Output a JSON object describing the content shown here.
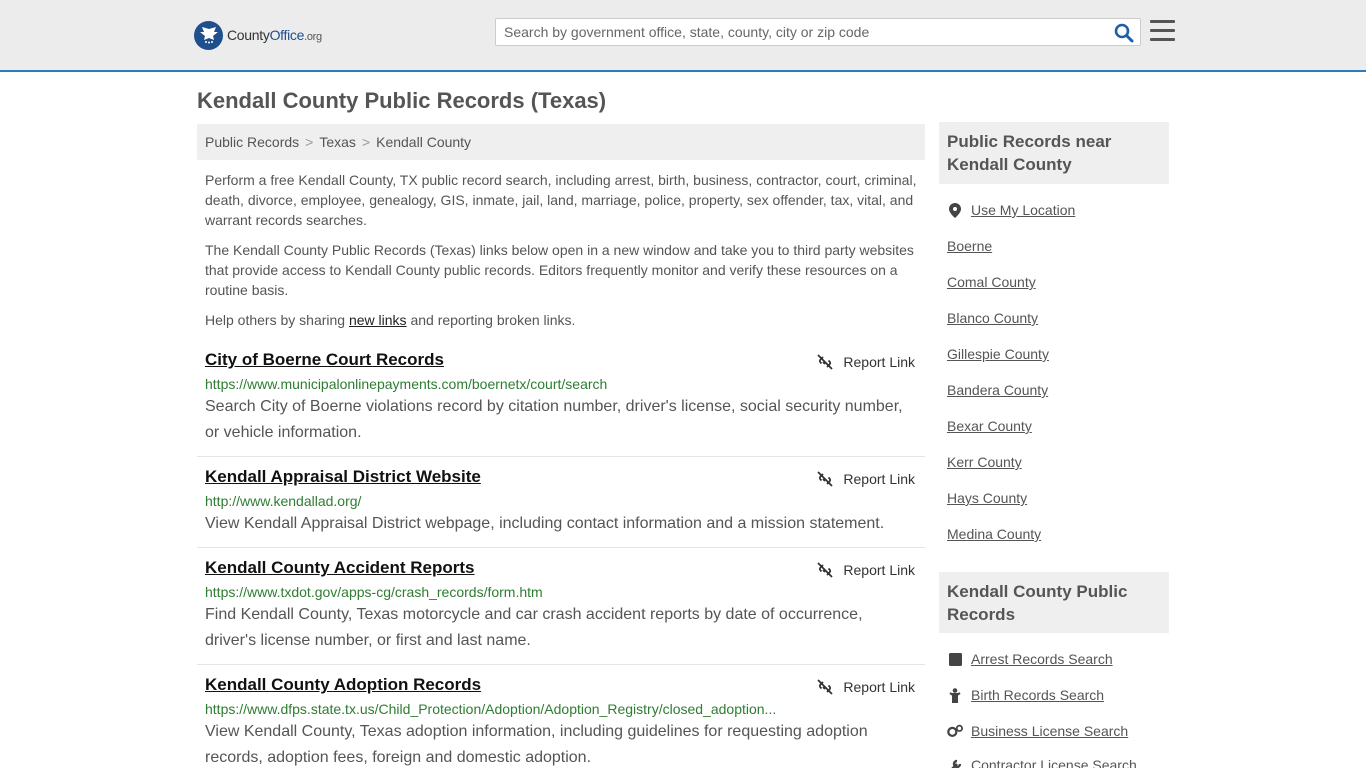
{
  "header": {
    "logo": {
      "brand_a": "County",
      "brand_b": "Office",
      "suffix": ".org"
    },
    "search_placeholder": "Search by government office, state, county, city or zip code",
    "icons": {
      "search": "search-icon",
      "menu": "hamburger-menu-icon"
    }
  },
  "page_title": "Kendall County Public Records (Texas)",
  "breadcrumb": [
    "Public Records",
    "Texas",
    "Kendall County"
  ],
  "intro": {
    "p1": "Perform a free Kendall County, TX public record search, including arrest, birth, business, contractor, court, criminal, death, divorce, employee, genealogy, GIS, inmate, jail, land, marriage, police, property, sex offender, tax, vital, and warrant records searches.",
    "p2": "The Kendall County Public Records (Texas) links below open in a new window and take you to third party websites that provide access to Kendall County public records. Editors frequently monitor and verify these resources on a routine basis.",
    "p3_before": "Help others by sharing ",
    "p3_link": "new links",
    "p3_after": " and reporting broken links."
  },
  "report_label": "Report Link",
  "records": [
    {
      "title": "City of Boerne Court Records",
      "url": "https://www.municipalonlinepayments.com/boernetx/court/search",
      "desc": "Search City of Boerne violations record by citation number, driver's license, social security number, or vehicle information."
    },
    {
      "title": "Kendall Appraisal District Website",
      "url": "http://www.kendallad.org/",
      "desc": "View Kendall Appraisal District webpage, including contact information and a mission statement."
    },
    {
      "title": "Kendall County Accident Reports",
      "url": "https://www.txdot.gov/apps-cg/crash_records/form.htm",
      "desc": "Find Kendall County, Texas motorcycle and car crash accident reports by date of occurrence, driver's license number, or first and last name."
    },
    {
      "title": "Kendall County Adoption Records",
      "url": "https://www.dfps.state.tx.us/Child_Protection/Adoption/Adoption_Registry/closed_adoption...",
      "desc": "View Kendall County, Texas adoption information, including guidelines for requesting adoption records, adoption fees, foreign and domestic adoption."
    }
  ],
  "sidebar": {
    "near_title": "Public Records near Kendall County",
    "use_location": "Use My Location",
    "near_links": [
      "Boerne",
      "Comal County",
      "Blanco County",
      "Gillespie County",
      "Bandera County",
      "Bexar County",
      "Kerr County",
      "Hays County",
      "Medina County"
    ],
    "records_title": "Kendall County Public Records",
    "record_links": [
      {
        "label": "Arrest Records Search",
        "icon": "square-icon"
      },
      {
        "label": "Birth Records Search",
        "icon": "baby-icon"
      },
      {
        "label": "Business License Search",
        "icon": "gears-icon"
      },
      {
        "label": "Contractor License Search",
        "icon": "tools-icon"
      }
    ]
  }
}
